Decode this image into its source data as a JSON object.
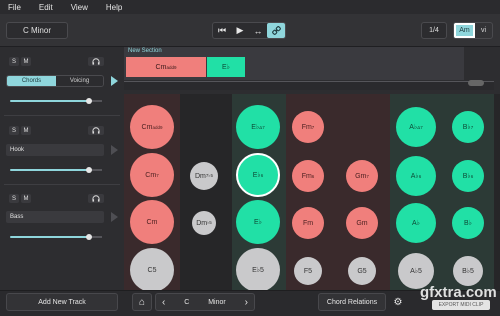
{
  "menu": [
    "File",
    "Edit",
    "View",
    "Help"
  ],
  "key": "C Minor",
  "transport": {
    "rewind": "⏮",
    "play": "▶",
    "loop": "↔",
    "link": "🔗"
  },
  "pager": "1/4",
  "modes": [
    "Am",
    "vi"
  ],
  "left": {
    "s_label": "S",
    "m_label": "M",
    "headphone": "🎧",
    "tabs": [
      "Chords",
      "Voicing"
    ],
    "tracks": [
      "Hook",
      "Bass"
    ]
  },
  "timeline": {
    "section": "New Section",
    "clip1": {
      "root": "Cm",
      "ext": "add9"
    },
    "clip2": "E♭"
  },
  "grid": {
    "c1": [
      {
        "root": "Cm",
        "sup": "add9"
      },
      {
        "root": "Cm",
        "sup": "7"
      },
      {
        "root": "Cm",
        "sup": ""
      },
      {
        "root": "C5",
        "sup": ""
      }
    ],
    "c2": [
      {
        "root": "Dm",
        "sup": "7♭5"
      },
      {
        "root": "Dm",
        "sup": "♭5"
      }
    ],
    "c3": [
      {
        "root": "E♭",
        "sup": "Δ7"
      },
      {
        "root": "E♭",
        "sup": "6"
      },
      {
        "root": "E♭",
        "sup": ""
      },
      {
        "root": "E♭5",
        "sup": ""
      }
    ],
    "c4": [
      {
        "root": "Fm",
        "sup": "7"
      },
      {
        "root": "Fm",
        "sup": "6"
      },
      {
        "root": "Fm",
        "sup": ""
      },
      {
        "root": "F5",
        "sup": ""
      }
    ],
    "c5": [
      {
        "root": "Gm",
        "sup": "7"
      },
      {
        "root": "Gm",
        "sup": ""
      },
      {
        "root": "G5",
        "sup": ""
      }
    ],
    "c6": [
      {
        "root": "A♭",
        "sup": "Δ7"
      },
      {
        "root": "A♭",
        "sup": "6"
      },
      {
        "root": "A♭",
        "sup": ""
      },
      {
        "root": "A♭5",
        "sup": ""
      }
    ],
    "c7": [
      {
        "root": "B♭",
        "sup": "7"
      },
      {
        "root": "B♭",
        "sup": "6"
      },
      {
        "root": "B♭",
        "sup": ""
      },
      {
        "root": "B♭5",
        "sup": ""
      }
    ]
  },
  "bottom": {
    "add_track": "Add New Track",
    "home": "⌂",
    "prev": "‹",
    "root": "C",
    "scale": "Minor",
    "next": "›",
    "relations": "Chord Relations",
    "gear": "⚙",
    "export": "EXPORT MIDI CLIP",
    "watermark": "gfxtra.com"
  },
  "colors": {
    "accent": "#8fd6dc",
    "chord_red": "#f07f7c",
    "chord_green": "#21e0a6",
    "chord_grey": "#c9c9cb"
  }
}
